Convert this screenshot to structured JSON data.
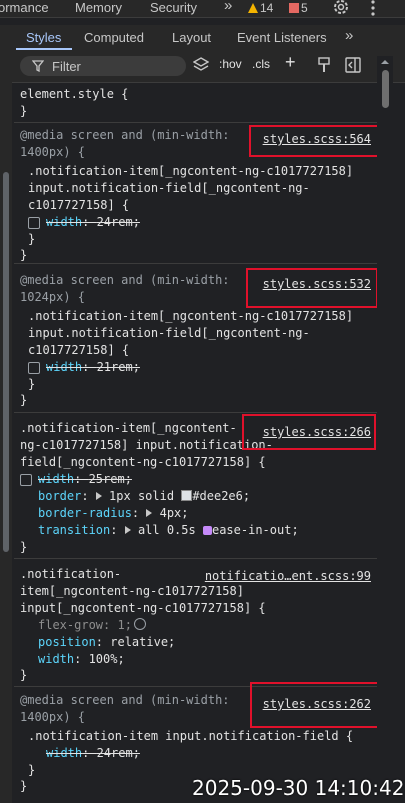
{
  "top_tabs": {
    "performance": "ormance",
    "memory": "Memory",
    "security": "Security",
    "more": "»",
    "warnings": "14",
    "errors": "5"
  },
  "sub_tabs": [
    "Styles",
    "Computed",
    "Layout",
    "Event Listeners",
    "»"
  ],
  "filter": {
    "placeholder": "Filter",
    "hov": ":hov",
    "cls": ".cls",
    "add": "+"
  },
  "rules": [
    {
      "lines": [
        "element.style {",
        "}"
      ]
    },
    {
      "media": [
        "@media screen and (min-width:",
        "1400px) {"
      ],
      "source": "styles.scss:564",
      "selector": [
        ".notification-item[_ngcontent-ng-c1017727158]",
        "input.notification-field[_ngcontent-ng-",
        "c1017727158] {"
      ],
      "decls": [
        {
          "name": "width",
          "value": "24rem"
        }
      ],
      "close": [
        "}",
        "}"
      ]
    },
    {
      "media": [
        "@media screen and (min-width:",
        "1024px) {"
      ],
      "source": "styles.scss:532",
      "selector": [
        ".notification-item[_ngcontent-ng-c1017727158]",
        "input.notification-field[_ngcontent-ng-",
        "c1017727158] {"
      ],
      "decls": [
        {
          "name": "width",
          "value": "21rem"
        }
      ],
      "close": [
        "}",
        "}"
      ]
    },
    {
      "source": "styles.scss:266",
      "selector": [
        ".notification-item[_ngcontent-",
        "ng-c1017727158] input.notification-",
        "field[_ngcontent-ng-c1017727158] {"
      ],
      "decls": [
        {
          "name": "width",
          "value": "25rem"
        },
        {
          "name": "border",
          "value": "1px solid",
          "color": "#dee2e6"
        },
        {
          "name": "border-radius",
          "value": "4px"
        },
        {
          "name": "transition",
          "value": "all 0.5s",
          "easing": "ease-in-out"
        }
      ],
      "close": [
        "}"
      ]
    },
    {
      "source": "notificatio…ent.scss:99",
      "selector": [
        ".notification-",
        "item[_ngcontent-ng-c1017727158]",
        "input[_ngcontent-ng-c1017727158] {"
      ],
      "decls": [
        {
          "name": "flex-grow",
          "value": "1"
        },
        {
          "name": "position",
          "value": "relative"
        },
        {
          "name": "width",
          "value": "100%"
        }
      ],
      "close": [
        "}"
      ]
    },
    {
      "media": [
        "@media screen and (min-width:",
        "1400px) {"
      ],
      "source": "styles.scss:262",
      "selector": [
        ".notification-item input.notification-field {"
      ],
      "decls": [
        {
          "name": "width",
          "value": "24rem"
        }
      ],
      "close": [
        "}",
        "}"
      ]
    }
  ],
  "timestamp": "2025-09-30 14:10:42"
}
